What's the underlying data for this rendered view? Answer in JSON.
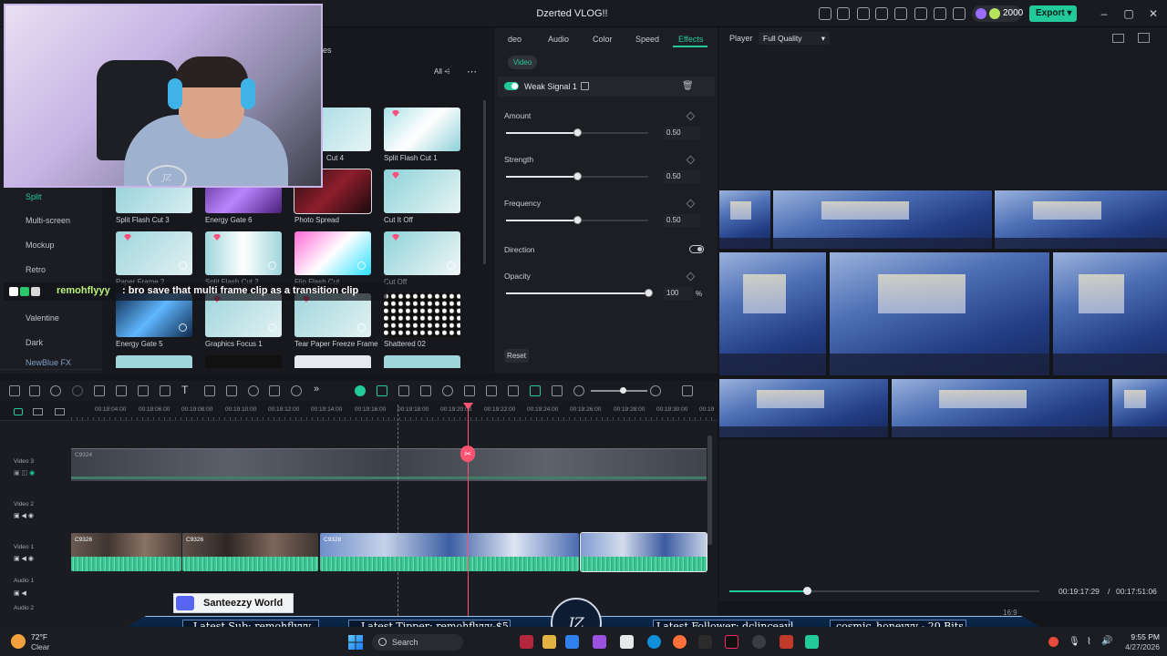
{
  "window": {
    "title": "Dzerted VLOG!!",
    "credits": "2000",
    "export_label": "Export",
    "accent": "#22c99a"
  },
  "left_panel": {
    "filter_label": "All",
    "categories": [
      "Split",
      "Multi-screen",
      "Mockup",
      "Retro",
      "Valentine",
      "Dark",
      "NewBlue FX"
    ],
    "active_category": "Split",
    "partial_tab": "es",
    "effects": [
      {
        "label": "Cut 4"
      },
      {
        "label": "Split Flash Cut 1"
      },
      {
        "label": "Split Flash Cut 3"
      },
      {
        "label": "Energy Gate 6"
      },
      {
        "label": "Photo Spread"
      },
      {
        "label": "Cut It Off"
      },
      {
        "label": "Paper Frame 2"
      },
      {
        "label": "Split Flash Cut 2"
      },
      {
        "label": "Flip Flash Cut"
      },
      {
        "label": "Cut Off"
      },
      {
        "label": "Energy Gate 5"
      },
      {
        "label": "Graphics Focus 1"
      },
      {
        "label": "Tear Paper Freeze Frame"
      },
      {
        "label": "Shattered 02"
      }
    ]
  },
  "properties": {
    "tabs": [
      "deo",
      "Audio",
      "Color",
      "Speed",
      "Effects"
    ],
    "active_tab": "Effects",
    "sub_tab": "Video",
    "effect_name": "Weak Signal 1",
    "params": [
      {
        "label": "Amount",
        "value": "0.50",
        "fraction": 0.5
      },
      {
        "label": "Strength",
        "value": "0.50",
        "fraction": 0.5
      },
      {
        "label": "Frequency",
        "value": "0.50",
        "fraction": 0.5
      }
    ],
    "direction_label": "Direction",
    "opacity": {
      "label": "Opacity",
      "value": "100",
      "unit": "%",
      "fraction": 1.0
    },
    "reset_label": "Reset"
  },
  "player": {
    "label": "Player",
    "quality": "Full Quality",
    "current_time": "00:19:17:29",
    "separator": "/",
    "total_time": "00:17:51:06",
    "aspect": "16:9",
    "progress": 0.25
  },
  "timeline": {
    "ticks": [
      "00:19:04:00",
      "00:19:06:00",
      "00:19:08:00",
      "00:19:10:00",
      "00:19:12:00",
      "00:19:14:00",
      "00:19:16:00",
      "00:19:18:00",
      "00:19:20:00",
      "00:19:22:00",
      "00:19:24:00",
      "00:19:26:00",
      "00:19:28:00",
      "00:19:30:00",
      "00:19"
    ],
    "tracks": [
      "Video 3",
      "Video 2",
      "Video 1",
      "Audio 1",
      "Audio 2"
    ],
    "clips": [
      {
        "name": "C9324"
      },
      {
        "name": "C9326"
      },
      {
        "name": "C9326"
      },
      {
        "name": "C9328"
      }
    ]
  },
  "stream_overlay": {
    "chat_user": "remohflyyy",
    "chat_message": ": bro save that multi frame clip as a transition clip",
    "discord_name": "Santeezzy World",
    "latest_sub": "Latest Sub: remohflyyy",
    "latest_tipper": "Latest Tipper: remohflyyy-$5",
    "latest_follower": "Latest Follower: dclinceayl",
    "bits": "cosmic_honeyyy - 20 Bits"
  },
  "taskbar": {
    "temperature": "72°F",
    "weather": "Clear",
    "search_placeholder": "Search",
    "time": "9:55 PM",
    "date": "4/27/2026"
  }
}
